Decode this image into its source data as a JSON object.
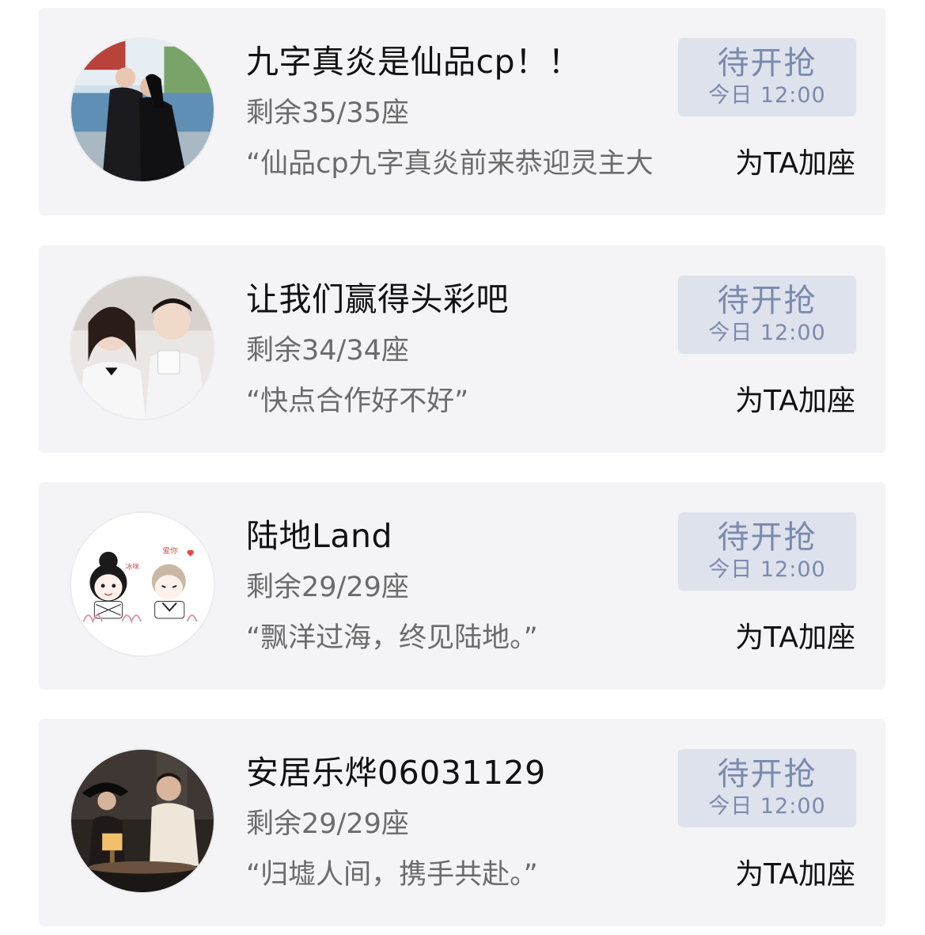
{
  "cards": [
    {
      "title": "九字真炎是仙品cp！！",
      "seats": "剩余35/35座",
      "quote": "“仙品cp九字真炎前来恭迎灵主大",
      "badge_main": "待开抢",
      "badge_time": "今日 12:00",
      "action": "为TA加座",
      "avatar": "couple-photo-outdoor"
    },
    {
      "title": "让我们赢得头彩吧",
      "seats": "剩余34/34座",
      "quote": "“快点合作好不好”",
      "badge_main": "待开抢",
      "badge_time": "今日 12:00",
      "action": "为TA加座",
      "avatar": "couple-photo-white-outfits"
    },
    {
      "title": "陆地Land",
      "seats": "剩余29/29座",
      "quote": "“飘洋过海，终见陆地。”",
      "badge_main": "待开抢",
      "badge_time": "今日 12:00",
      "action": "为TA加座",
      "avatar": "cartoon-couple-drawing",
      "avatar_text": [
        "冰咪",
        "爱你"
      ]
    },
    {
      "title": "安居乐烨06031129",
      "seats": "剩余29/29座",
      "quote": "“归墟人间，携手共赴。”",
      "badge_main": "待开抢",
      "badge_time": "今日 12:00",
      "action": "为TA加座",
      "avatar": "couple-photo-cafe-night"
    }
  ],
  "colors": {
    "card_bg": "#f4f4f6",
    "badge_bg": "#dde2ec",
    "badge_text": "#7b89ad",
    "title_text": "#111111",
    "secondary_text": "#6b6b6b"
  }
}
